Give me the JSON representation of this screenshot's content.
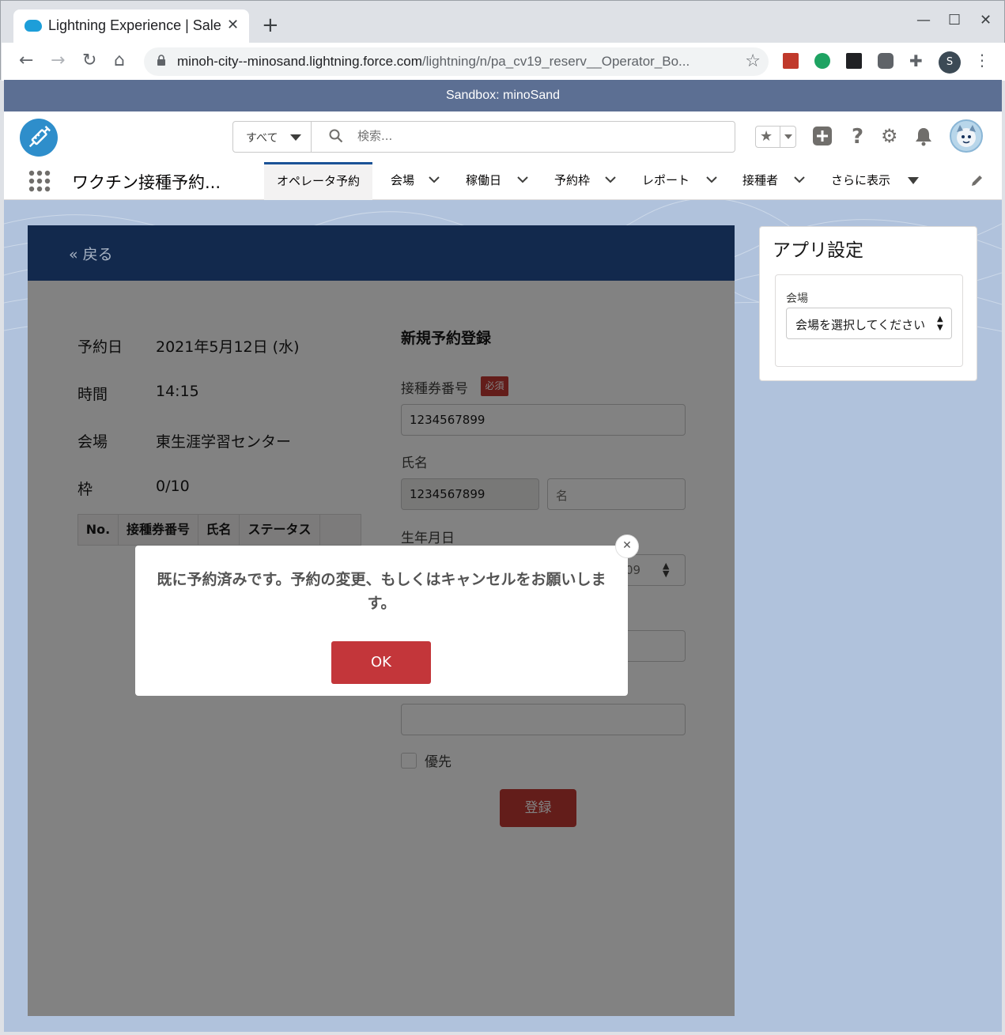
{
  "browser": {
    "tab_title": "Lightning Experience | Salesforce",
    "tab_close": "✕",
    "new_tab": "+",
    "url_host": "minoh-city--minosand.lightning.force.com",
    "url_path": "/lightning/n/pa_cv19_reserv__Operator_Bo...",
    "profile_initial": "S",
    "minimize": "—",
    "maximize": "☐",
    "close": "✕"
  },
  "sandbox_banner": "Sandbox: minoSand",
  "header": {
    "search_scope": "すべて",
    "search_placeholder": "検索..."
  },
  "nav": {
    "app_name": "ワクチン接種予約...",
    "items": [
      {
        "label": "オペレータ予約"
      },
      {
        "label": "会場"
      },
      {
        "label": "稼働日"
      },
      {
        "label": "予約枠"
      },
      {
        "label": "レポート"
      },
      {
        "label": "接種者"
      },
      {
        "label": "さらに表示"
      }
    ]
  },
  "back": {
    "label": "戻る"
  },
  "reservation": {
    "date_label": "予約日",
    "date_value": "2021年5月12日 (水)",
    "time_label": "時間",
    "time_value": "14:15",
    "venue_label": "会場",
    "venue_value": "東生涯学習センター",
    "slot_label": "枠",
    "slot_value": "0/10",
    "table_headers": [
      "No.",
      "接種券番号",
      "氏名",
      "ステータス"
    ]
  },
  "form": {
    "title": "新規予約登録",
    "ticket_label": "接種券番号",
    "required_badge": "必須",
    "ticket_value": "1234567899",
    "name_label": "氏名",
    "last_name_value": "1234567899",
    "first_name_placeholder": "名",
    "dob_label": "生年月日",
    "dob_partial": "09",
    "priority_label": "優先",
    "register_label": "登録"
  },
  "settings": {
    "title": "アプリ設定",
    "venue_label": "会場",
    "venue_select": "会場を選択してください"
  },
  "modal": {
    "message": "既に予約済みです。予約の変更、もしくはキャンセルをお願いします。",
    "ok_label": "OK",
    "close": "✕"
  }
}
